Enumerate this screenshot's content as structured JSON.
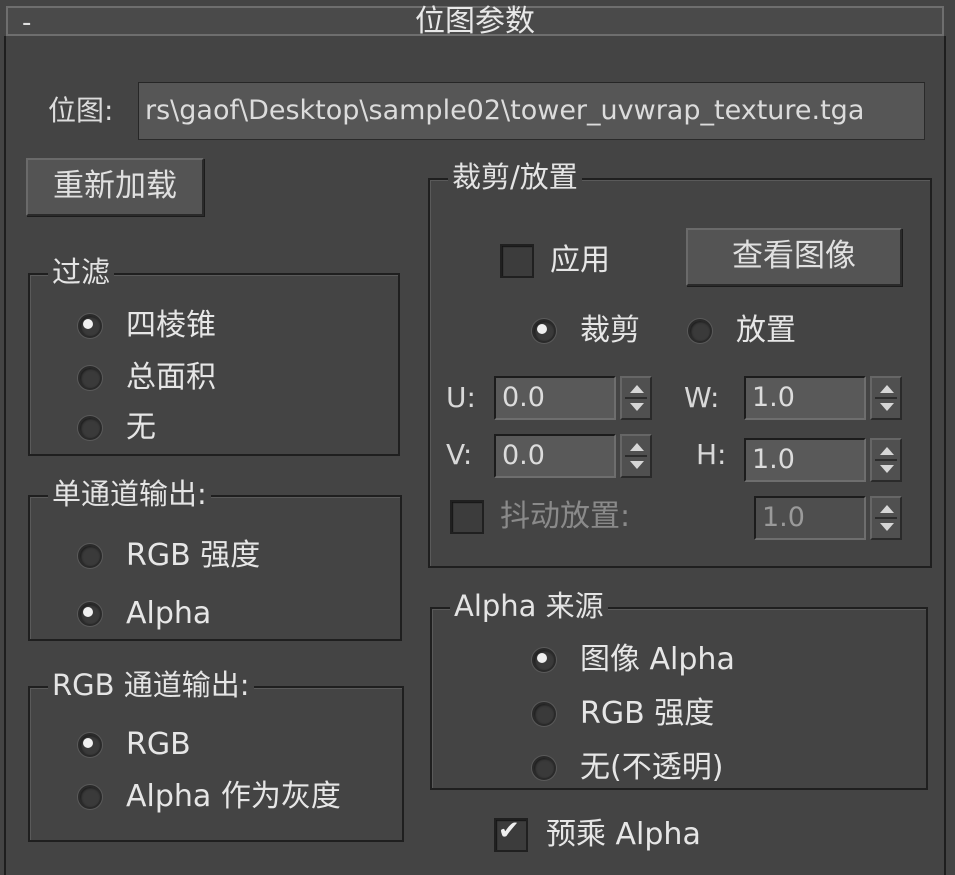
{
  "rollout": {
    "collapse_symbol": "-",
    "title": "位图参数"
  },
  "bitmap": {
    "label": "位图:",
    "path": "rs\\gaof\\Desktop\\sample02\\tower_uvwrap_texture.tga"
  },
  "reload_button": "重新加载",
  "filtering": {
    "title": "过滤",
    "options": [
      "四棱锥",
      "总面积",
      "无"
    ],
    "selected": "四棱锥"
  },
  "mono_output": {
    "title": "单通道输出:",
    "options": [
      "RGB 强度",
      "Alpha"
    ],
    "selected": "Alpha"
  },
  "rgb_output": {
    "title": "RGB 通道输出:",
    "options": [
      "RGB",
      "Alpha 作为灰度"
    ],
    "selected": "RGB"
  },
  "crop_place": {
    "title": "裁剪/放置",
    "apply_label": "应用",
    "apply_checked": false,
    "view_image_button": "查看图像",
    "mode_options": [
      "裁剪",
      "放置"
    ],
    "mode_selected": "裁剪",
    "u_label": "U:",
    "u_value": "0.0",
    "v_label": "V:",
    "v_value": "0.0",
    "w_label": "W:",
    "w_value": "1.0",
    "h_label": "H:",
    "h_value": "1.0",
    "jitter_label": "抖动放置:",
    "jitter_checked": false,
    "jitter_value": "1.0"
  },
  "alpha_source": {
    "title": "Alpha 来源",
    "options": [
      "图像 Alpha",
      "RGB 强度",
      "无(不透明)"
    ],
    "selected": "图像 Alpha"
  },
  "premultiplied": {
    "label": "预乘 Alpha",
    "checked": true
  }
}
